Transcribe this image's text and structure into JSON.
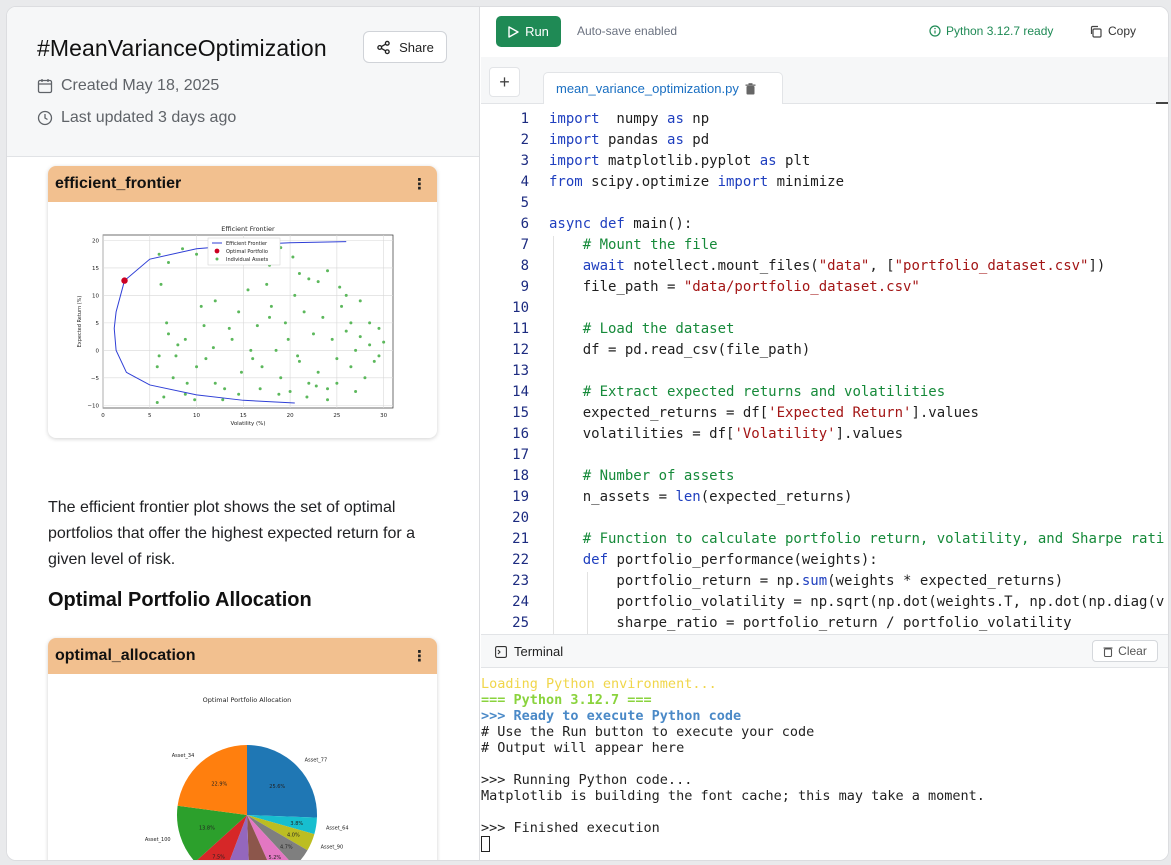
{
  "header": {
    "title": "#MeanVarianceOptimization",
    "share_label": "Share",
    "created": "Created May 18, 2025",
    "updated": "Last updated 3 days ago"
  },
  "cards": {
    "frontier_title": "efficient_frontier",
    "allocation_title": "optimal_allocation",
    "kebab": "⋮"
  },
  "body": {
    "paragraph": "The efficient frontier plot shows the set of optimal portfolios that offer the highest expected return for a given level of risk.",
    "heading": "Optimal Portfolio Allocation"
  },
  "chart_data": [
    {
      "type": "scatter",
      "title": "Efficient Frontier",
      "xlabel": "Volatility (%)",
      "ylabel": "Expected Return (%)",
      "xlim": [
        0,
        31
      ],
      "ylim": [
        -10.5,
        21
      ],
      "xticks": [
        "0",
        "5",
        "10",
        "15",
        "20",
        "25",
        "30"
      ],
      "yticks": [
        "20",
        "15",
        "10",
        "5",
        "0",
        "−5",
        "−10"
      ],
      "legend": [
        "Efficient Frontier",
        "Optimal Portfolio",
        "Individual Assets"
      ],
      "legend_position": "top-center",
      "grid": true,
      "colors": {
        "frontier": "#2f3fd6",
        "optimal": "#cc0022",
        "assets": "#5cb85c"
      },
      "frontier": [
        {
          "x": 20.5,
          "y": -9.6
        },
        {
          "x": 15,
          "y": -9.1
        },
        {
          "x": 10,
          "y": -8.1
        },
        {
          "x": 5,
          "y": -6.3
        },
        {
          "x": 2.5,
          "y": -4
        },
        {
          "x": 1.4,
          "y": 0
        },
        {
          "x": 1.2,
          "y": 4
        },
        {
          "x": 1.4,
          "y": 7
        },
        {
          "x": 2.3,
          "y": 12.7
        },
        {
          "x": 5,
          "y": 16.6
        },
        {
          "x": 10,
          "y": 18.5
        },
        {
          "x": 15,
          "y": 19.2
        },
        {
          "x": 20,
          "y": 19.6
        },
        {
          "x": 26,
          "y": 19.8
        }
      ],
      "optimal": {
        "x": 2.3,
        "y": 12.7
      },
      "assets": [
        [
          6,
          17.5
        ],
        [
          8.5,
          18.5
        ],
        [
          6.2,
          12
        ],
        [
          7,
          16
        ],
        [
          10,
          17.5
        ],
        [
          11.5,
          17
        ],
        [
          13,
          17.2
        ],
        [
          15.5,
          17.5
        ],
        [
          16.5,
          16.5
        ],
        [
          17.8,
          15.5
        ],
        [
          19,
          18.7
        ],
        [
          20.3,
          17
        ],
        [
          21,
          14
        ],
        [
          22,
          13
        ],
        [
          23,
          12.5
        ],
        [
          24,
          14.5
        ],
        [
          25.3,
          11.5
        ],
        [
          26,
          10
        ],
        [
          27.5,
          9
        ],
        [
          28.5,
          5
        ],
        [
          29.5,
          4
        ],
        [
          30,
          1.5
        ],
        [
          29,
          -2
        ],
        [
          28,
          -5
        ],
        [
          27,
          -7.5
        ],
        [
          26.5,
          -3
        ],
        [
          25,
          -6
        ],
        [
          24,
          -7
        ],
        [
          23,
          -4
        ],
        [
          22,
          -6
        ],
        [
          21,
          -2
        ],
        [
          20,
          -7.5
        ],
        [
          19,
          -5
        ],
        [
          18.5,
          0
        ],
        [
          17,
          -3
        ],
        [
          16,
          -1.5
        ],
        [
          14.5,
          -8
        ],
        [
          13,
          -7
        ],
        [
          12,
          -6
        ],
        [
          11,
          -1.5
        ],
        [
          10,
          -3
        ],
        [
          9,
          -6
        ],
        [
          8,
          1
        ],
        [
          7,
          3
        ],
        [
          6,
          -1
        ],
        [
          5.8,
          -3
        ],
        [
          6.5,
          -8.5
        ],
        [
          7.5,
          -5
        ],
        [
          8.8,
          -8
        ],
        [
          10.5,
          8
        ],
        [
          12,
          9
        ],
        [
          13.5,
          4
        ],
        [
          14.5,
          7
        ],
        [
          15.5,
          11
        ],
        [
          16.5,
          4.5
        ],
        [
          17.5,
          12
        ],
        [
          18,
          8
        ],
        [
          19.5,
          5
        ],
        [
          20.5,
          10
        ],
        [
          21.5,
          7
        ],
        [
          22.5,
          3
        ],
        [
          23.5,
          6
        ],
        [
          24.5,
          2
        ],
        [
          25.5,
          8
        ],
        [
          26.5,
          5
        ],
        [
          27.5,
          2.5
        ],
        [
          28.5,
          1
        ],
        [
          29.5,
          -1
        ],
        [
          27,
          0
        ],
        [
          26,
          3.5
        ],
        [
          25,
          -1.5
        ],
        [
          24,
          -9
        ],
        [
          22.8,
          -6.5
        ],
        [
          21.8,
          -8.5
        ],
        [
          20.8,
          -1
        ],
        [
          19.8,
          2
        ],
        [
          18.8,
          -8
        ],
        [
          17.8,
          6
        ],
        [
          16.8,
          -7
        ],
        [
          15.8,
          0
        ],
        [
          14.8,
          -4
        ],
        [
          13.8,
          2
        ],
        [
          12.8,
          -9
        ],
        [
          11.8,
          0.5
        ],
        [
          10.8,
          4.5
        ],
        [
          9.8,
          -9
        ],
        [
          8.8,
          2
        ],
        [
          7.8,
          -1
        ],
        [
          6.8,
          5
        ],
        [
          5.8,
          -9.5
        ]
      ]
    },
    {
      "type": "pie",
      "title": "Optimal Portfolio Allocation",
      "slices": [
        {
          "label": "Asset_77",
          "value": 25.6,
          "color": "#1f77b4"
        },
        {
          "label": "Asset_64",
          "value": 3.8,
          "color": "#17becf"
        },
        {
          "label": "Asset_90",
          "value": 4.0,
          "color": "#bcbd22"
        },
        {
          "label": "Asset_65",
          "value": 4.7,
          "color": "#7f7f7f"
        },
        {
          "label": "Asset_78",
          "value": 5.2,
          "color": "#e377c2"
        },
        {
          "label": "",
          "value": 6.1,
          "color": "#8c564b"
        },
        {
          "label": "",
          "value": 6.4,
          "color": "#9467bd"
        },
        {
          "label": "Asset_68",
          "value": 7.5,
          "color": "#d62728"
        },
        {
          "label": "Asset_100",
          "value": 13.8,
          "color": "#2ca02c"
        },
        {
          "label": "Asset_34",
          "value": 22.9,
          "color": "#ff7f0e"
        }
      ]
    }
  ],
  "toolbar": {
    "run_label": "Run",
    "autosave": "Auto-save enabled",
    "status": "Python 3.12.7 ready",
    "copy_label": "Copy"
  },
  "editor": {
    "add_tab": "+",
    "filename": "mean_variance_optimization.py",
    "lines": [
      {
        "n": "1",
        "segs": [
          [
            "kw",
            "import"
          ],
          [
            "",
            "  numpy "
          ],
          [
            "kw",
            "as"
          ],
          [
            "",
            " np"
          ]
        ]
      },
      {
        "n": "2",
        "segs": [
          [
            "kw",
            "import"
          ],
          [
            "",
            " pandas "
          ],
          [
            "kw",
            "as"
          ],
          [
            "",
            " pd"
          ]
        ]
      },
      {
        "n": "3",
        "segs": [
          [
            "kw",
            "import"
          ],
          [
            "",
            " matplotlib.pyplot "
          ],
          [
            "kw",
            "as"
          ],
          [
            "",
            " plt"
          ]
        ]
      },
      {
        "n": "4",
        "segs": [
          [
            "kw",
            "from"
          ],
          [
            "",
            " scipy.optimize "
          ],
          [
            "kw",
            "import"
          ],
          [
            "",
            " minimize"
          ]
        ]
      },
      {
        "n": "5",
        "segs": []
      },
      {
        "n": "6",
        "segs": [
          [
            "kw",
            "async def"
          ],
          [
            "",
            " main():"
          ]
        ]
      },
      {
        "n": "7",
        "segs": [
          [
            "",
            "    "
          ],
          [
            "cm",
            "# Mount the file"
          ]
        ]
      },
      {
        "n": "8",
        "segs": [
          [
            "",
            "    "
          ],
          [
            "kw",
            "await"
          ],
          [
            "",
            " notellect.mount_files("
          ],
          [
            "st",
            "\"data\""
          ],
          [
            "",
            ", ["
          ],
          [
            "st",
            "\"portfolio_dataset.csv\""
          ],
          [
            "",
            "])"
          ]
        ]
      },
      {
        "n": "9",
        "segs": [
          [
            "",
            "    file_path = "
          ],
          [
            "st",
            "\"data/portfolio_dataset.csv\""
          ]
        ]
      },
      {
        "n": "10",
        "segs": []
      },
      {
        "n": "11",
        "segs": [
          [
            "",
            "    "
          ],
          [
            "cm",
            "# Load the dataset"
          ]
        ]
      },
      {
        "n": "12",
        "segs": [
          [
            "",
            "    df = pd.read_csv(file_path)"
          ]
        ]
      },
      {
        "n": "13",
        "segs": []
      },
      {
        "n": "14",
        "segs": [
          [
            "",
            "    "
          ],
          [
            "cm",
            "# Extract expected returns and volatilities"
          ]
        ]
      },
      {
        "n": "15",
        "segs": [
          [
            "",
            "    expected_returns = df["
          ],
          [
            "st",
            "'Expected Return'"
          ],
          [
            "",
            "].values"
          ]
        ]
      },
      {
        "n": "16",
        "segs": [
          [
            "",
            "    volatilities = df["
          ],
          [
            "st",
            "'Volatility'"
          ],
          [
            "",
            "].values"
          ]
        ]
      },
      {
        "n": "17",
        "segs": []
      },
      {
        "n": "18",
        "segs": [
          [
            "",
            "    "
          ],
          [
            "cm",
            "# Number of assets"
          ]
        ]
      },
      {
        "n": "19",
        "segs": [
          [
            "",
            "    n_assets = "
          ],
          [
            "kw",
            "len"
          ],
          [
            "",
            "(expected_returns)"
          ]
        ]
      },
      {
        "n": "20",
        "segs": []
      },
      {
        "n": "21",
        "segs": [
          [
            "",
            "    "
          ],
          [
            "cm",
            "# Function to calculate portfolio return, volatility, and Sharpe rati"
          ]
        ]
      },
      {
        "n": "22",
        "segs": [
          [
            "",
            "    "
          ],
          [
            "kw",
            "def"
          ],
          [
            "",
            " portfolio_performance(weights):"
          ]
        ]
      },
      {
        "n": "23",
        "segs": [
          [
            "",
            "        portfolio_return = np."
          ],
          [
            "kw",
            "sum"
          ],
          [
            "",
            "(weights * expected_returns)"
          ]
        ]
      },
      {
        "n": "24",
        "segs": [
          [
            "",
            "        portfolio_volatility = np.sqrt(np.dot(weights.T, np.dot(np.diag(v"
          ]
        ]
      },
      {
        "n": "25",
        "segs": [
          [
            "",
            "        sharpe_ratio = portfolio_return / portfolio_volatility"
          ]
        ]
      }
    ]
  },
  "terminal": {
    "title": "Terminal",
    "clear_label": "Clear",
    "lines": [
      {
        "cls": "t-yellow",
        "text": "Loading Python environment..."
      },
      {
        "cls": "t-green",
        "text": "=== Python 3.12.7 ==="
      },
      {
        "cls": "t-blue",
        "text": ">>> Ready to execute Python code"
      },
      {
        "cls": "t-normal",
        "text": "# Use the Run button to execute your code"
      },
      {
        "cls": "t-normal",
        "text": "# Output will appear here"
      },
      {
        "cls": "t-normal",
        "text": ""
      },
      {
        "cls": "t-normal",
        "text": ">>> Running Python code..."
      },
      {
        "cls": "t-normal",
        "text": "Matplotlib is building the font cache; this may take a moment."
      },
      {
        "cls": "t-normal",
        "text": ""
      },
      {
        "cls": "t-normal",
        "text": ">>> Finished execution"
      }
    ]
  }
}
